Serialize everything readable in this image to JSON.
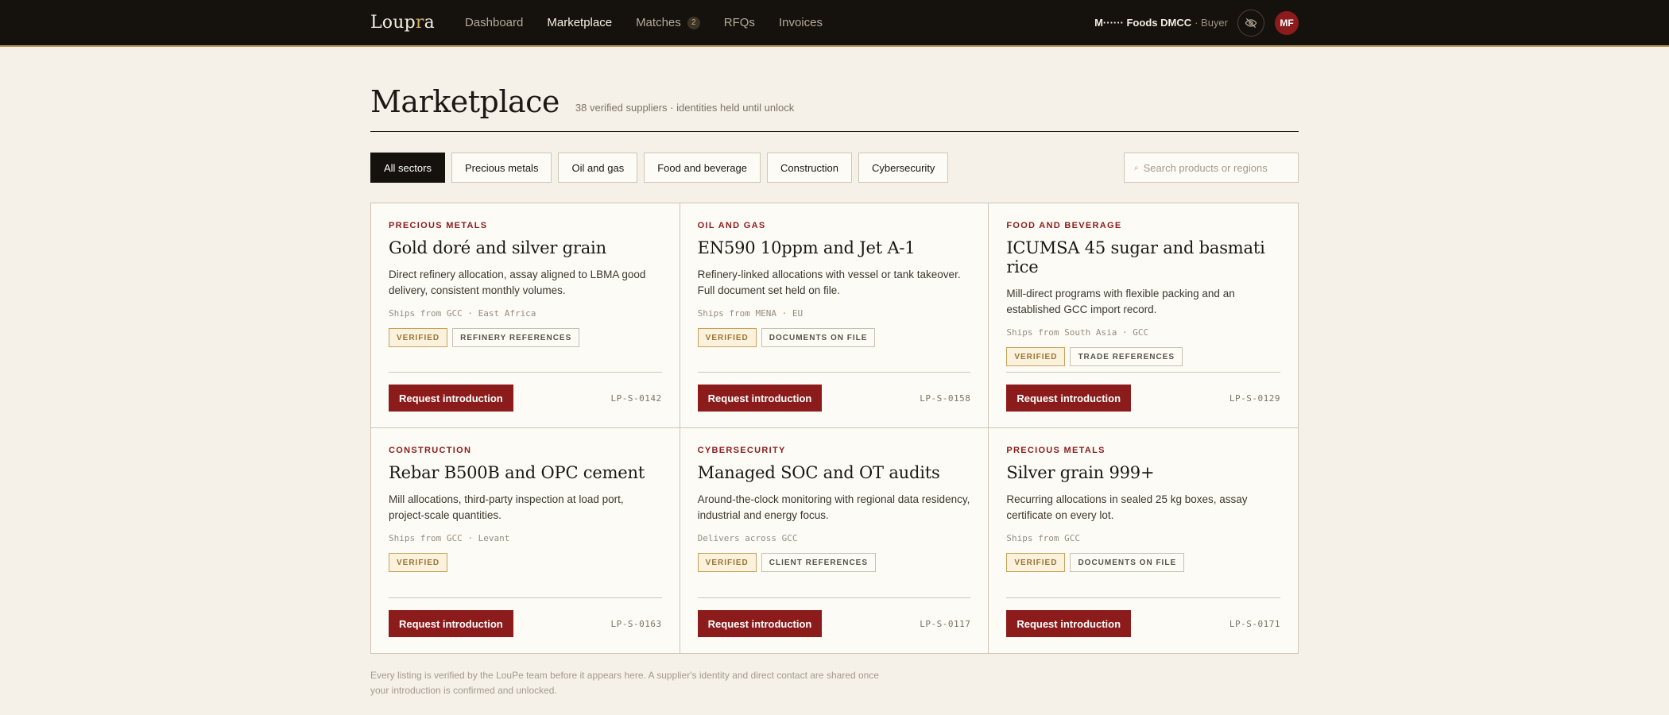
{
  "nav": {
    "brand_prefix": "Loup",
    "brand_accent": "r",
    "brand_suffix": "a",
    "items": [
      {
        "label": "Dashboard"
      },
      {
        "label": "Marketplace",
        "active": true
      },
      {
        "label": "Matches",
        "badge": "2"
      },
      {
        "label": "RFQs"
      },
      {
        "label": "Invoices"
      }
    ],
    "account_name": "M······ Foods DMCC",
    "account_role": "· Buyer",
    "avatar_initials": "MF",
    "privacy_icon": "eye-off-icon"
  },
  "header": {
    "title": "Marketplace",
    "subtitle": "38 verified suppliers · identities held until unlock"
  },
  "filters": {
    "chips": [
      {
        "label": "All sectors",
        "active": true
      },
      {
        "label": "Precious metals"
      },
      {
        "label": "Oil and gas"
      },
      {
        "label": "Food and beverage"
      },
      {
        "label": "Construction"
      },
      {
        "label": "Cybersecurity"
      }
    ],
    "search_placeholder": "Search products or regions",
    "search_value": ""
  },
  "listings": [
    {
      "sector": "Precious metals",
      "title": "Gold doré and silver grain",
      "description": "Direct refinery allocation, assay aligned to LBMA good delivery, consistent monthly volumes.",
      "ships": "Ships from GCC · East Africa",
      "tags": [
        "Verified",
        "Refinery references"
      ],
      "button": "Request introduction",
      "id": "LP-S-0142"
    },
    {
      "sector": "Oil and gas",
      "title": "EN590 10ppm and Jet A-1",
      "description": "Refinery-linked allocations with vessel or tank takeover. Full document set held on file.",
      "ships": "Ships from MENA · EU",
      "tags": [
        "Verified",
        "Documents on file"
      ],
      "button": "Request introduction",
      "id": "LP-S-0158"
    },
    {
      "sector": "Food and beverage",
      "title": "ICUMSA 45 sugar and basmati rice",
      "description": "Mill-direct programs with flexible packing and an established GCC import record.",
      "ships": "Ships from South Asia · GCC",
      "tags": [
        "Verified",
        "Trade references"
      ],
      "button": "Request introduction",
      "id": "LP-S-0129"
    },
    {
      "sector": "Construction",
      "title": "Rebar B500B and OPC cement",
      "description": "Mill allocations, third-party inspection at load port, project-scale quantities.",
      "ships": "Ships from GCC · Levant",
      "tags": [
        "Verified"
      ],
      "button": "Request introduction",
      "id": "LP-S-0163"
    },
    {
      "sector": "Cybersecurity",
      "title": "Managed SOC and OT audits",
      "description": "Around-the-clock monitoring with regional data residency, industrial and energy focus.",
      "ships": "Delivers across GCC",
      "tags": [
        "Verified",
        "Client references"
      ],
      "button": "Request introduction",
      "id": "LP-S-0117"
    },
    {
      "sector": "Precious metals",
      "title": "Silver grain 999+",
      "description": "Recurring allocations in sealed 25 kg boxes, assay certificate on every lot.",
      "ships": "Ships from GCC",
      "tags": [
        "Verified",
        "Documents on file"
      ],
      "button": "Request introduction",
      "id": "LP-S-0171"
    }
  ],
  "footer": {
    "note": "Every listing is verified by the LouPe team before it appears here. A supplier's identity and direct contact are shared once your introduction is confirmed and unlocked."
  },
  "colors": {
    "accent_red": "#8c1b1b",
    "gold": "#c8a15a",
    "background": "#f5f1e8",
    "topbar": "#15120d"
  }
}
